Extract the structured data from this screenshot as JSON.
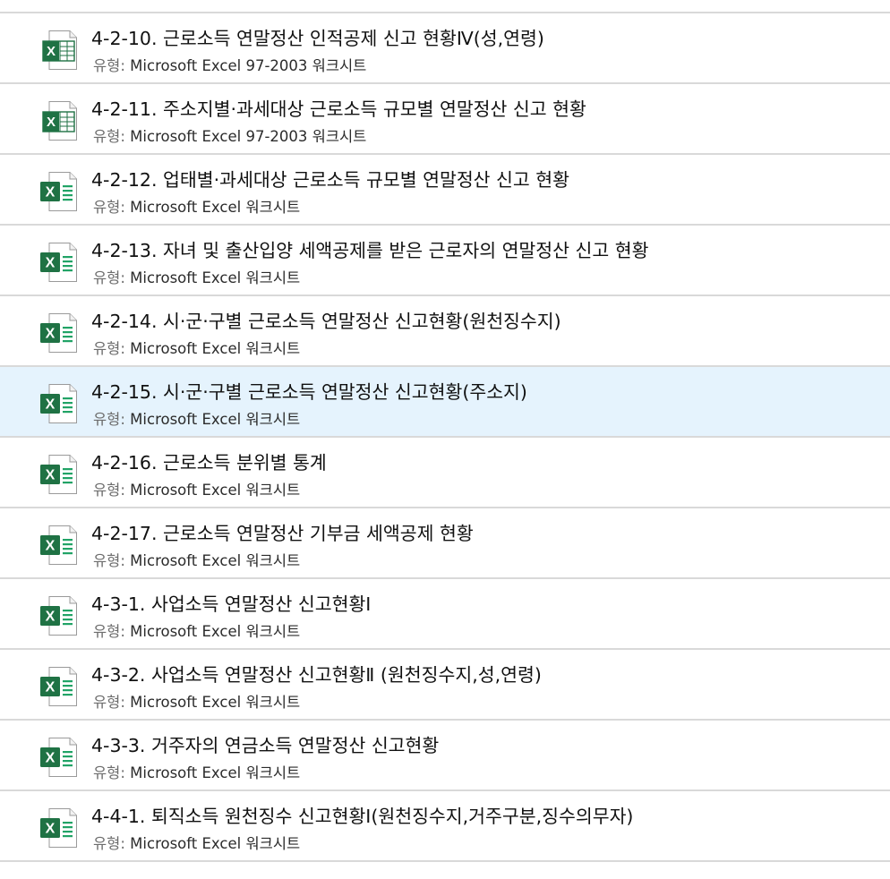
{
  "type_prefix": "유형: ",
  "colors": {
    "excel_green": "#1f7244",
    "excel_light": "#21a366",
    "selected_bg": "#e5f3fd",
    "divider": "#d9d9d9"
  },
  "files": [
    {
      "name": "4-2-10. 근로소득 연말정산 인적공제 신고 현황Ⅳ(성,연령)",
      "type": "Microsoft Excel 97-2003 워크시트",
      "icon": "excel-97-2003-icon",
      "selected": false
    },
    {
      "name": "4-2-11. 주소지별·과세대상 근로소득 규모별 연말정산 신고 현황",
      "type": "Microsoft Excel 97-2003 워크시트",
      "icon": "excel-97-2003-icon",
      "selected": false
    },
    {
      "name": "4-2-12. 업태별·과세대상 근로소득 규모별 연말정산 신고 현황",
      "type": "Microsoft Excel 워크시트",
      "icon": "excel-icon",
      "selected": false
    },
    {
      "name": "4-2-13. 자녀 및 출산입양 세액공제를 받은 근로자의 연말정산 신고 현황",
      "type": "Microsoft Excel 워크시트",
      "icon": "excel-icon",
      "selected": false
    },
    {
      "name": "4-2-14. 시·군·구별 근로소득 연말정산 신고현황(원천징수지)",
      "type": "Microsoft Excel 워크시트",
      "icon": "excel-icon",
      "selected": false
    },
    {
      "name": "4-2-15. 시·군·구별 근로소득 연말정산 신고현황(주소지)",
      "type": "Microsoft Excel 워크시트",
      "icon": "excel-icon",
      "selected": true
    },
    {
      "name": "4-2-16. 근로소득 분위별 통계",
      "type": "Microsoft Excel 워크시트",
      "icon": "excel-icon",
      "selected": false
    },
    {
      "name": "4-2-17. 근로소득 연말정산 기부금 세액공제 현황",
      "type": "Microsoft Excel 워크시트",
      "icon": "excel-icon",
      "selected": false
    },
    {
      "name": "4-3-1. 사업소득 연말정산 신고현황Ⅰ",
      "type": "Microsoft Excel 워크시트",
      "icon": "excel-icon",
      "selected": false
    },
    {
      "name": "4-3-2. 사업소득 연말정산 신고현황Ⅱ (원천징수지,성,연령)",
      "type": "Microsoft Excel 워크시트",
      "icon": "excel-icon",
      "selected": false
    },
    {
      "name": "4-3-3. 거주자의 연금소득 연말정산 신고현황",
      "type": "Microsoft Excel 워크시트",
      "icon": "excel-icon",
      "selected": false
    },
    {
      "name": "4-4-1. 퇴직소득 원천징수 신고현황Ⅰ(원천징수지,거주구분,징수의무자)",
      "type": "Microsoft Excel 워크시트",
      "icon": "excel-icon",
      "selected": false
    }
  ]
}
